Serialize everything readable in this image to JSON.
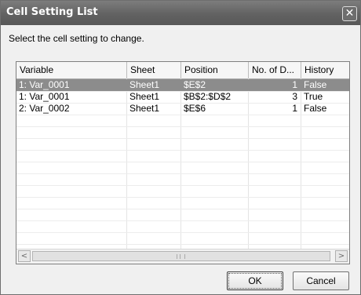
{
  "window": {
    "title": "Cell Setting List",
    "close_glyph": "✕"
  },
  "prompt": "Select the cell setting to change.",
  "table": {
    "columns": [
      "Variable",
      "Sheet",
      "Position",
      "No. of D...",
      "History"
    ],
    "rows": [
      {
        "variable": "1: Var_0001",
        "sheet": "Sheet1",
        "position": "$E$2",
        "count": "1",
        "history": "False",
        "selected": true
      },
      {
        "variable": "1: Var_0001",
        "sheet": "Sheet1",
        "position": "$B$2:$D$2",
        "count": "3",
        "history": "True",
        "selected": false
      },
      {
        "variable": "2: Var_0002",
        "sheet": "Sheet1",
        "position": "$E$6",
        "count": "1",
        "history": "False",
        "selected": false
      }
    ]
  },
  "scrollbar": {
    "left_glyph": "<",
    "right_glyph": ">"
  },
  "buttons": {
    "ok": "OK",
    "cancel": "Cancel"
  },
  "colors": {
    "titlebar": "#626262",
    "selection": "#8c8c8c"
  }
}
